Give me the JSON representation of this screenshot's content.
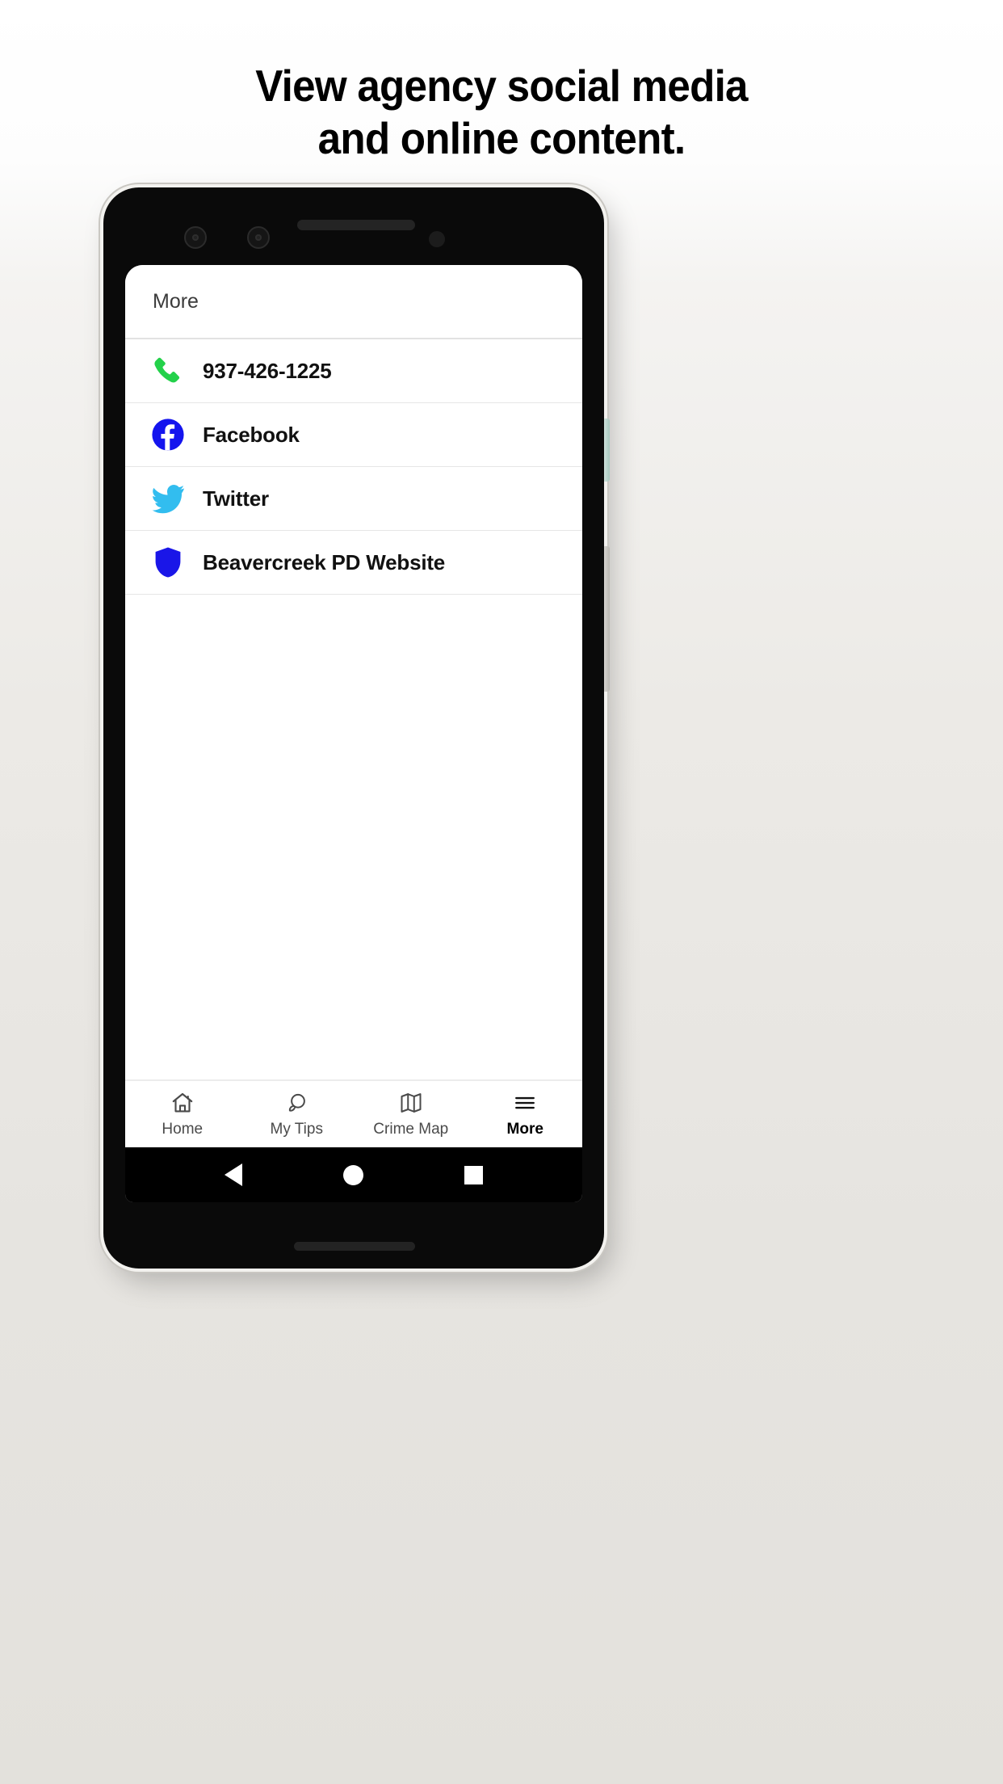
{
  "promo": {
    "headline_line1": "View agency social media",
    "headline_line2": "and online content."
  },
  "app": {
    "header": {
      "title": "More"
    },
    "more_list": [
      {
        "icon": "phone-icon",
        "label": "937-426-1225",
        "color": "#23d14a"
      },
      {
        "icon": "facebook-icon",
        "label": "Facebook",
        "color": "#1414ee"
      },
      {
        "icon": "twitter-icon",
        "label": "Twitter",
        "color": "#32bdef"
      },
      {
        "icon": "shield-icon",
        "label": "Beavercreek PD Website",
        "color": "#1a16e8"
      }
    ],
    "tabs": [
      {
        "icon": "home-icon",
        "label": "Home",
        "active": false
      },
      {
        "icon": "chat-icon",
        "label": "My Tips",
        "active": false
      },
      {
        "icon": "map-icon",
        "label": "Crime Map",
        "active": false
      },
      {
        "icon": "hamburger-icon",
        "label": "More",
        "active": true
      }
    ],
    "system_nav": [
      {
        "icon": "back-triangle-icon"
      },
      {
        "icon": "home-circle-icon"
      },
      {
        "icon": "recents-square-icon"
      }
    ]
  }
}
